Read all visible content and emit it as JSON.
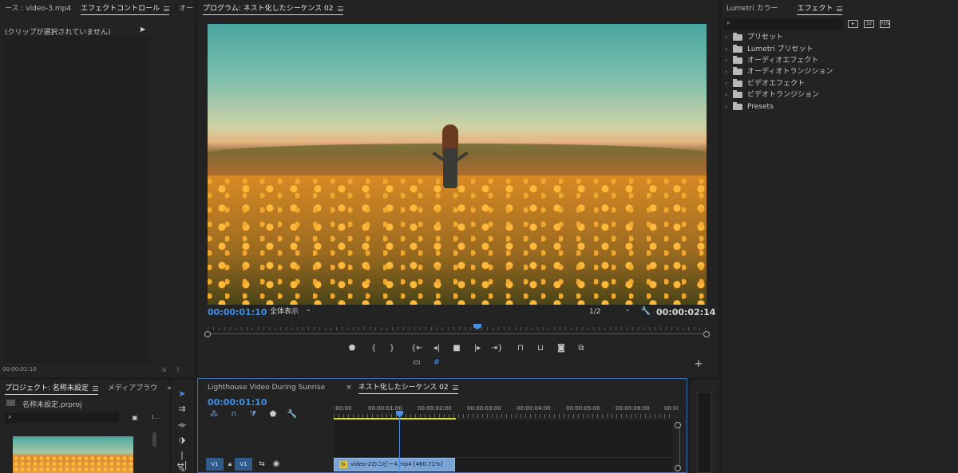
{
  "effect_controls": {
    "tabs": [
      "ース : video-3.mp4",
      "エフェクトコントロール",
      "オー"
    ],
    "placeholder": "(クリップが選択されていません)",
    "timecode": "00:00:01:10"
  },
  "program": {
    "title": "プログラム: ネスト化したシーケンス 02",
    "timecode_current": "00:00:01:10",
    "zoom": "全体表示",
    "resolution": "1/2",
    "timecode_duration": "00:00:02:14"
  },
  "effects_panel": {
    "tabs": [
      "Lumetri カラー",
      "エフェクト"
    ],
    "items": [
      "プリセット",
      "Lumetri プリセット",
      "オーディオエフェクト",
      "オーディオトランジション",
      "ビデオエフェクト",
      "ビデオトランジション",
      "Presets"
    ],
    "badges": [
      "32",
      "YUV"
    ]
  },
  "project": {
    "tabs": [
      "プロジェクト: 名称未設定",
      "メディアブラウ"
    ],
    "file": "名称未設定.prproj",
    "count": "1..."
  },
  "timeline": {
    "tabs": [
      "Lighthouse Video During Sunrise",
      "ネスト化したシーケンス 02"
    ],
    "timecode": "00:00:01:10",
    "ruler": [
      ":00:00",
      "00:00:01:00",
      "00:00:02:00",
      "00:00:03:00",
      "00:00:04:00",
      "00:00:05:00",
      "00:00:06:00",
      "00:0("
    ],
    "track_source": "V1",
    "track_target": "V1",
    "clip_label": "video-2のコピー4.mp4 [460.71%]",
    "clip_fx": "fx"
  },
  "colors": {
    "accent": "#3f8fe8",
    "clip": "#7aa3d6",
    "workarea": "#d8d83a"
  }
}
